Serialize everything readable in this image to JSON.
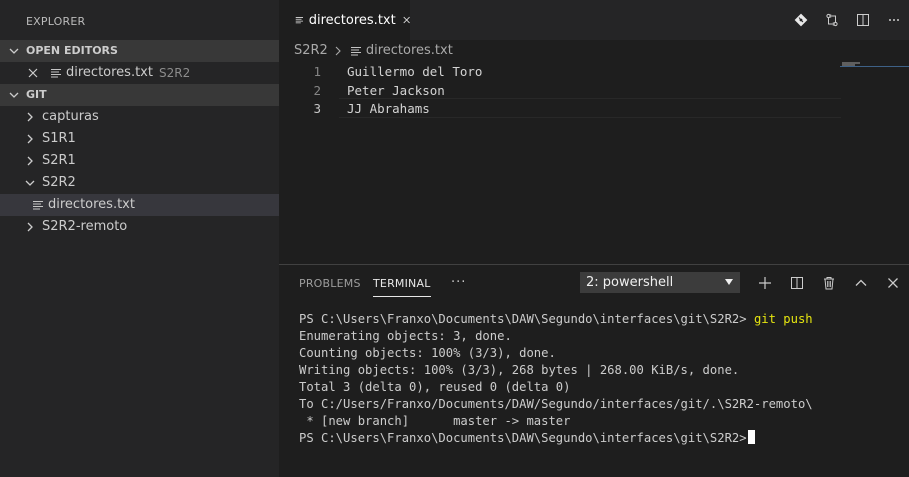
{
  "sidebar": {
    "title": "EXPLORER",
    "open_editors": {
      "header": "OPEN EDITORS",
      "items": [
        {
          "label": "directores.txt",
          "description": "S2R2"
        }
      ]
    },
    "git": {
      "header": "GIT",
      "items": [
        {
          "label": "capturas",
          "type": "folder",
          "expanded": false
        },
        {
          "label": "S1R1",
          "type": "folder",
          "expanded": false
        },
        {
          "label": "S2R1",
          "type": "folder",
          "expanded": false
        },
        {
          "label": "S2R2",
          "type": "folder",
          "expanded": true
        },
        {
          "label": "directores.txt",
          "type": "file",
          "selected": true
        },
        {
          "label": "S2R2-remoto",
          "type": "folder",
          "expanded": false
        }
      ]
    }
  },
  "editor": {
    "tab_label": "directores.txt",
    "breadcrumb": {
      "folder": "S2R2",
      "file": "directores.txt"
    },
    "lines": [
      {
        "num": "1",
        "text": "Guillermo del Toro"
      },
      {
        "num": "2",
        "text": "Peter Jackson"
      },
      {
        "num": "3",
        "text": "JJ Abrahams"
      }
    ],
    "actions": [
      "git-icon",
      "compare-icon",
      "split-editor-icon",
      "more-icon"
    ]
  },
  "panel": {
    "tabs": {
      "problems": "PROBLEMS",
      "terminal": "TERMINAL",
      "more": "···"
    },
    "terminal_select": "2: powershell",
    "actions": [
      "add-icon",
      "split-icon",
      "trash-icon",
      "chevron-up-icon",
      "close-icon"
    ],
    "terminal": {
      "prompt1": "PS C:\\Users\\Franxo\\Documents\\DAW\\Segundo\\interfaces\\git\\S2R2> ",
      "command": "git push",
      "output": [
        "Enumerating objects: 3, done.",
        "Counting objects: 100% (3/3), done.",
        "Writing objects: 100% (3/3), 268 bytes | 268.00 KiB/s, done.",
        "Total 3 (delta 0), reused 0 (delta 0)",
        "To C:/Users/Franxo/Documents/DAW/Segundo/interfaces/git/.\\S2R2-remoto\\",
        " * [new branch]      master -> master"
      ],
      "prompt2": "PS C:\\Users\\Franxo\\Documents\\DAW\\Segundo\\interfaces\\git\\S2R2>"
    }
  },
  "colors": {
    "sidebar_bg": "#252526",
    "editor_bg": "#1e1e1e",
    "section_header_bg": "#383838",
    "selected_bg": "#37373d",
    "command_yellow": "#e5e510"
  }
}
